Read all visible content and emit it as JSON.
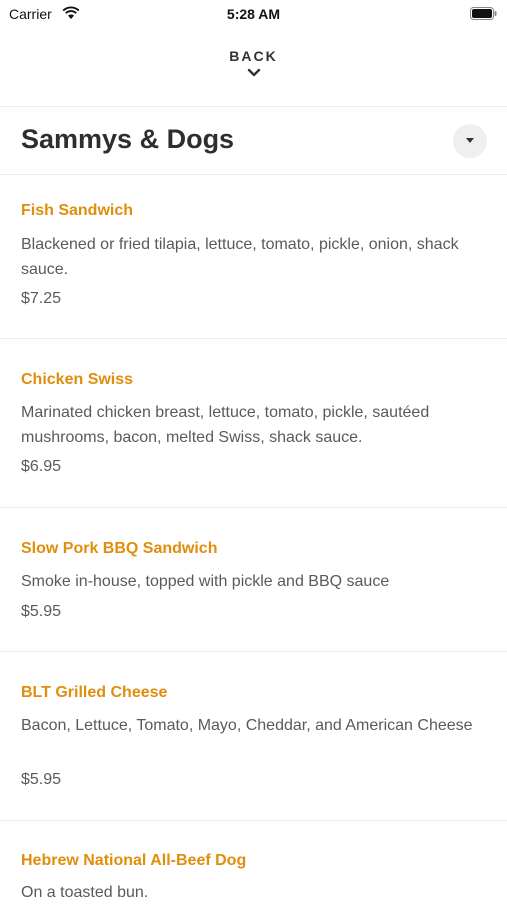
{
  "status_bar": {
    "carrier": "Carrier",
    "time": "5:28 AM"
  },
  "nav": {
    "back_label": "BACK"
  },
  "section": {
    "title": "Sammys & Dogs"
  },
  "colors": {
    "accent": "#e08e0b",
    "text": "#5a5a5a",
    "divider": "#ececec"
  },
  "items": [
    {
      "name": "Fish Sandwich",
      "description": "Blackened or fried tilapia, lettuce, tomato, pickle, onion, shack sauce.",
      "price": "$7.25"
    },
    {
      "name": "Chicken Swiss",
      "description": "Marinated chicken breast, lettuce, tomato, pickle, sautéed mushrooms, bacon, melted Swiss, shack sauce.",
      "price": "$6.95"
    },
    {
      "name": "Slow Pork BBQ Sandwich",
      "description": "Smoke in-house, topped with pickle and BBQ sauce",
      "price": "$5.95"
    },
    {
      "name": "BLT Grilled Cheese",
      "description": "Bacon, Lettuce, Tomato, Mayo, Cheddar, and American Cheese",
      "price": "$5.95"
    },
    {
      "name": "Hebrew National All-Beef Dog",
      "description": "On a toasted bun.",
      "price": ""
    }
  ]
}
